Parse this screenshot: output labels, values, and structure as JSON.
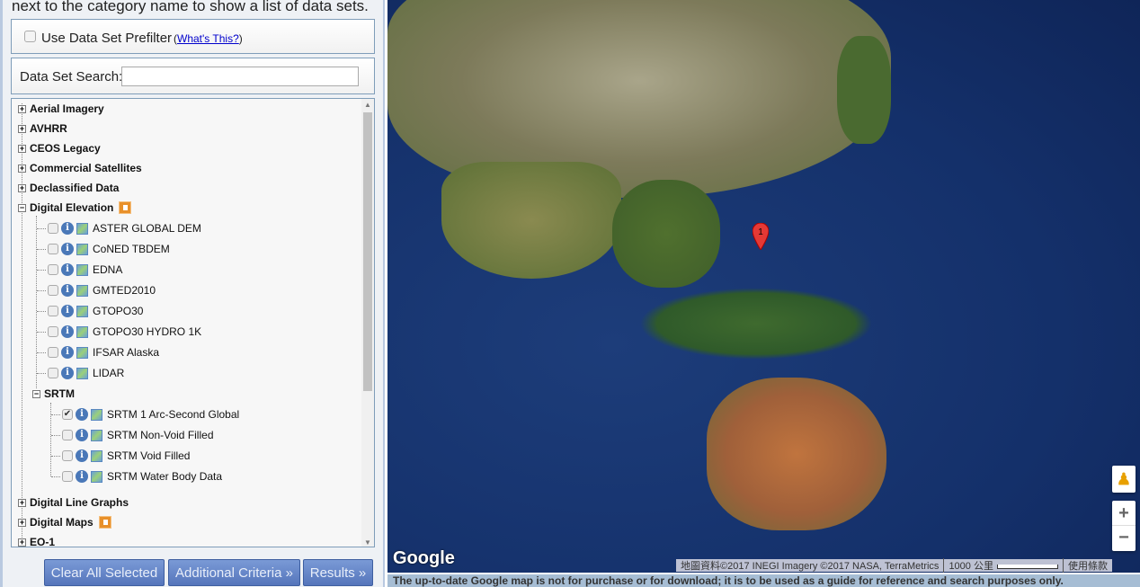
{
  "left": {
    "intro": "next to the category name to show a list of data sets.",
    "prefilter": {
      "label": "Use Data Set Prefilter",
      "paren_open": "(",
      "link": "What's This?",
      "paren_close": ")",
      "checked": false
    },
    "search": {
      "label": "Data Set Search:",
      "value": "",
      "placeholder": ""
    },
    "categories_top": [
      "Aerial Imagery",
      "AVHRR",
      "CEOS Legacy",
      "Commercial Satellites",
      "Declassified Data"
    ],
    "digital_elevation": {
      "label": "Digital Elevation",
      "items": [
        "ASTER GLOBAL DEM",
        "CoNED TBDEM",
        "EDNA",
        "GMTED2010",
        "GTOPO30",
        "GTOPO30 HYDRO 1K",
        "IFSAR Alaska",
        "LIDAR"
      ],
      "srtm": {
        "label": "SRTM",
        "items": [
          {
            "label": "SRTM 1 Arc-Second Global",
            "checked": true
          },
          {
            "label": "SRTM Non-Void Filled",
            "checked": false
          },
          {
            "label": "SRTM Void Filled",
            "checked": false
          },
          {
            "label": "SRTM Water Body Data",
            "checked": false
          }
        ]
      }
    },
    "categories_bottom": [
      "Digital Line Graphs",
      "Digital Maps",
      "EO-1"
    ],
    "buttons": {
      "clear": "Clear All Selected",
      "criteria": "Additional Criteria »",
      "results": "Results »"
    }
  },
  "map": {
    "marker_label": "1",
    "logo": "Google",
    "attribution": "地圖資料©2017 INEGI Imagery ©2017 NASA, TerraMetrics",
    "scale": "1000 公里",
    "terms": "使用條款",
    "zoom_in": "+",
    "zoom_out": "−",
    "disclaimer": "The up-to-date Google map is not for purchase or for download; it is to be used as a guide for reference and search purposes only."
  },
  "colors": {
    "button": "#5f7fc3",
    "badge": "#e8902a",
    "marker": "#e53935"
  }
}
